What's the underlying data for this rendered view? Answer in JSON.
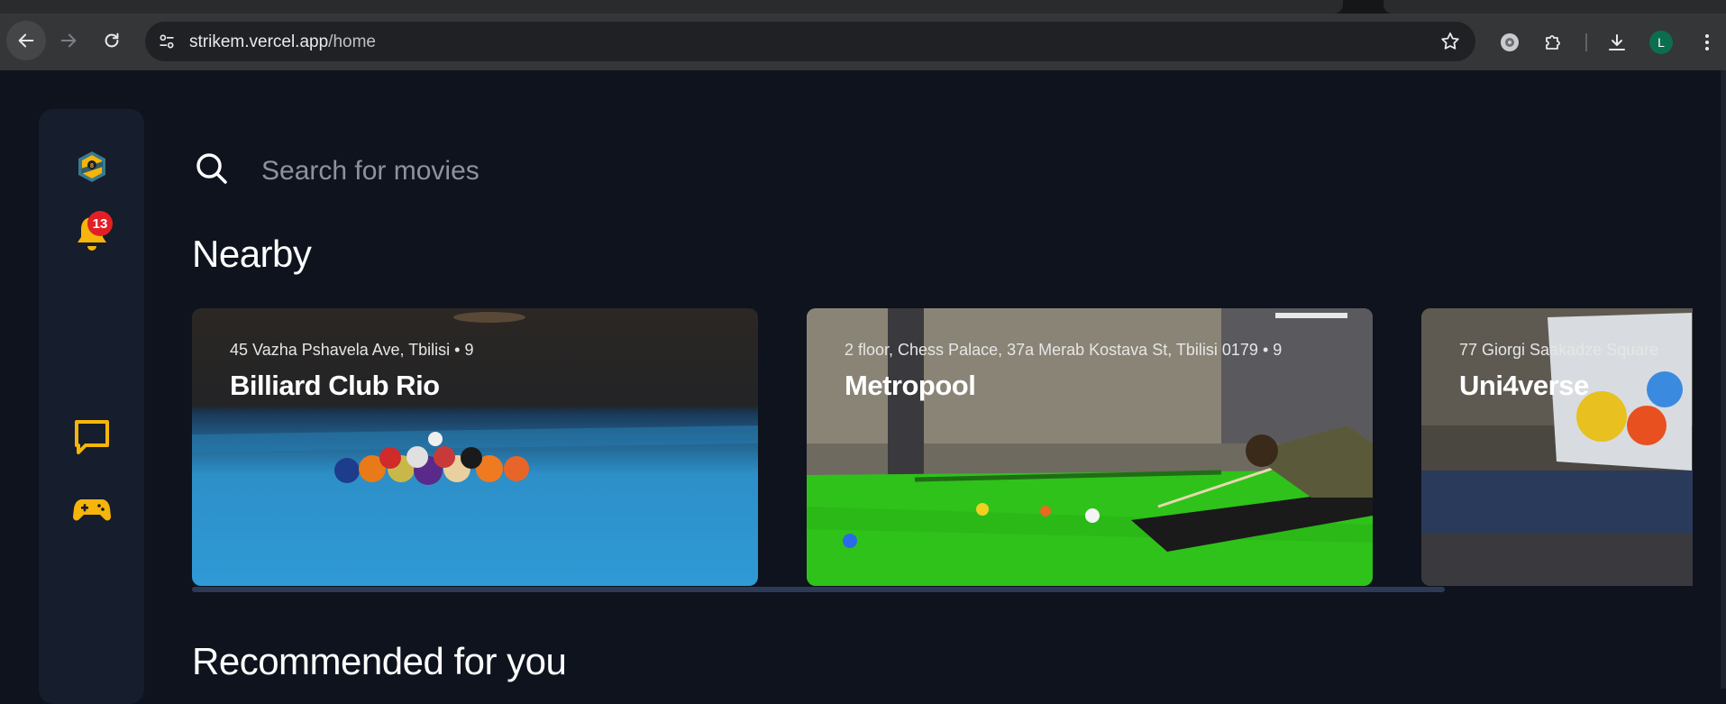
{
  "browser": {
    "url_host": "strikem.vercel.app",
    "url_path": "/home",
    "profile_initial": "L",
    "profile_color": "#0b6e4f"
  },
  "sidebar": {
    "notification_count": "13",
    "accent_color": "#f5b50a",
    "icons": [
      "logo-icon",
      "bell-icon",
      "chat-icon",
      "gamepad-icon"
    ]
  },
  "search": {
    "placeholder": "Search for movies"
  },
  "sections": {
    "nearby_title": "Nearby",
    "recommended_title": "Recommended for you"
  },
  "nearby": [
    {
      "address": "45 Vazha Pshavela Ave, Tbilisi",
      "separator": "•",
      "rating": "9",
      "name": "Billiard Club Rio"
    },
    {
      "address": "2 floor, Chess Palace, 37a Merab Kostava St, Tbilisi 0179",
      "separator": "•",
      "rating": "9",
      "name": "Metropool"
    },
    {
      "address": "77 Giorgi Saakadze Square",
      "name": "Uni4verse"
    }
  ]
}
